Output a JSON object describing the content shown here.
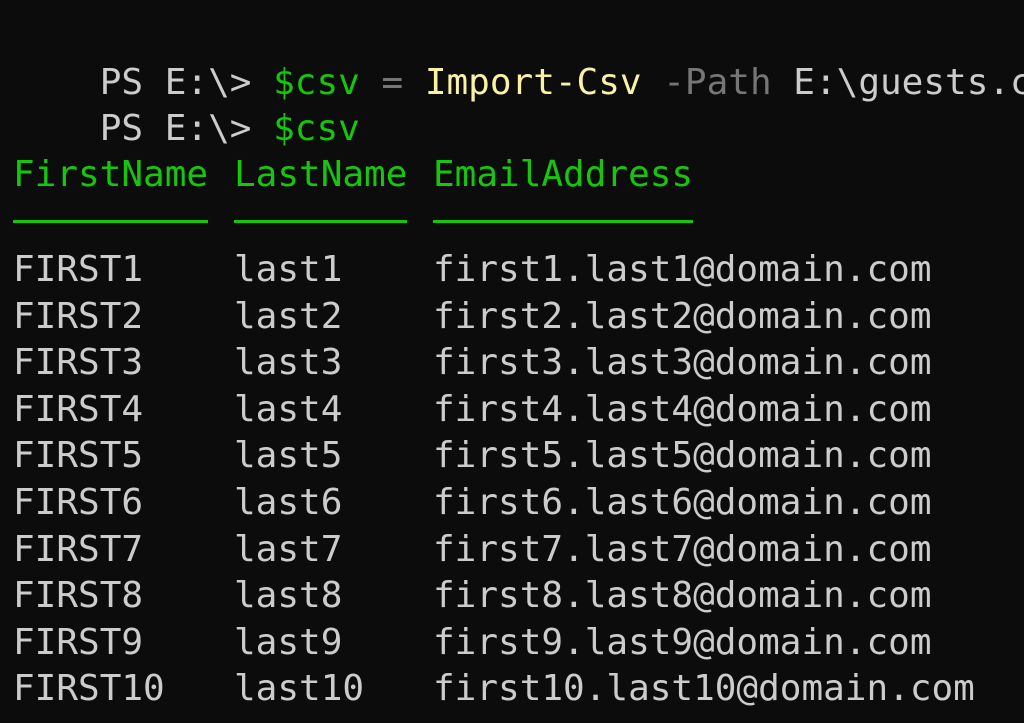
{
  "prompt_lines": [
    {
      "prompt": "PS E:\\> ",
      "variable": "$csv",
      "operator": " = ",
      "command": "Import-Csv",
      "parameter": " -Path",
      "argument": " E:\\guests.csv"
    },
    {
      "prompt": "PS E:\\> ",
      "variable": "$csv"
    }
  ],
  "table": {
    "columns": [
      "FirstName",
      "LastName",
      "EmailAddress"
    ],
    "rows": [
      [
        "FIRST1",
        "last1",
        "first1.last1@domain.com"
      ],
      [
        "FIRST2",
        "last2",
        "first2.last2@domain.com"
      ],
      [
        "FIRST3",
        "last3",
        "first3.last3@domain.com"
      ],
      [
        "FIRST4",
        "last4",
        "first4.last4@domain.com"
      ],
      [
        "FIRST5",
        "last5",
        "first5.last5@domain.com"
      ],
      [
        "FIRST6",
        "last6",
        "first6.last6@domain.com"
      ],
      [
        "FIRST7",
        "last7",
        "first7.last7@domain.com"
      ],
      [
        "FIRST8",
        "last8",
        "first8.last8@domain.com"
      ],
      [
        "FIRST9",
        "last9",
        "first9.last9@domain.com"
      ],
      [
        "FIRST10",
        "last10",
        "first10.last10@domain.com"
      ]
    ]
  },
  "colors": {
    "background": "#0c0c0c",
    "text": "#cccccc",
    "variable": "#16c60c",
    "command": "#f9f1a5",
    "parameter": "#767676",
    "table_header": "#16c60c"
  }
}
